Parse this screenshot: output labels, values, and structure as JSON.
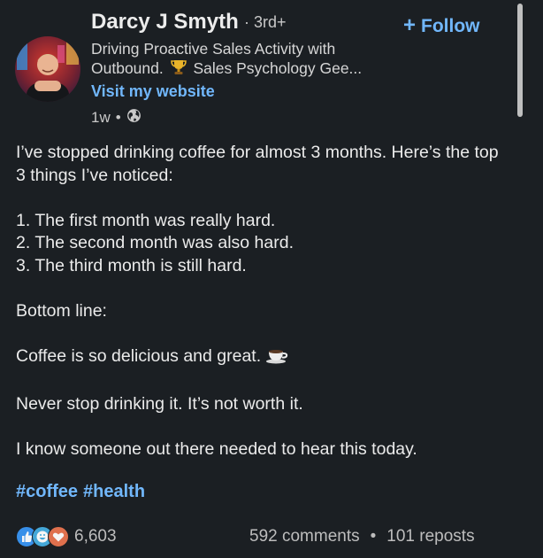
{
  "author": {
    "name": "Darcy J Smyth",
    "degree": "· 3rd+",
    "headline_line1": "Driving Proactive Sales Activity with",
    "headline_line2_a": "Outbound.",
    "headline_line2_b": "Sales Psychology Gee...",
    "website_link": "Visit my website",
    "timestamp": "1w",
    "visibility_icon": "globe-icon"
  },
  "follow": {
    "plus": "+",
    "label": "Follow"
  },
  "post": {
    "lines": [
      "I’ve stopped drinking coffee for almost 3 months. Here’s the top 3 things I’ve noticed:",
      "1. The first month was really hard.",
      "2. The second month was also hard.",
      "3. The third month is still hard.",
      "Bottom line:",
      "Coffee is so delicious and great.",
      "Never stop drinking it. It’s not worth it.",
      "I know someone out there needed to hear this today."
    ],
    "hashtags": [
      "#coffee",
      "#health"
    ]
  },
  "social": {
    "reaction_icons": [
      "like-icon",
      "funny-icon",
      "love-icon"
    ],
    "reaction_count": "6,603",
    "comments": "592 comments",
    "separator": "•",
    "reposts": "101 reposts"
  },
  "colors": {
    "background": "#1b1f23",
    "link": "#71b7fb",
    "text": "#ebebeb",
    "secondary_text": "#bdbdbd"
  }
}
